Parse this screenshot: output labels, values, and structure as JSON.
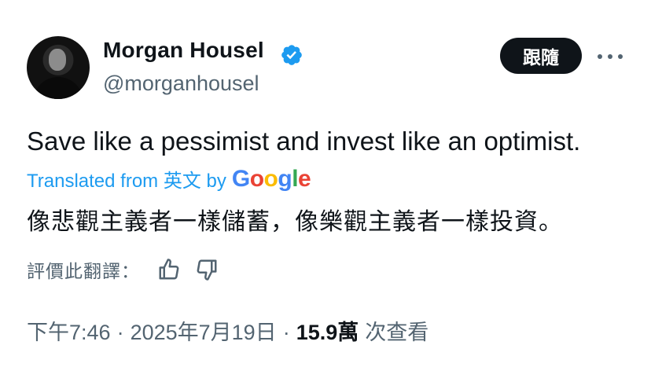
{
  "author": {
    "name": "Morgan Housel",
    "handle": "@morganhousel",
    "verified": true,
    "avatar_icon": "avatar"
  },
  "actions": {
    "follow_label": "跟隨",
    "more_icon": "more-icon"
  },
  "tweet": {
    "text": "Save like a pessimist and invest like an optimist."
  },
  "translation": {
    "label": "Translated from 英文 by",
    "provider": "Google",
    "text": "像悲觀主義者一樣儲蓄，像樂觀主義者一樣投資。"
  },
  "rating": {
    "label": "評價此翻譯：",
    "up_icon": "thumbs-up-icon",
    "down_icon": "thumbs-down-icon"
  },
  "meta": {
    "time": "下午7:46",
    "date": "2025年7月19日",
    "separator": "·",
    "views_count": "15.9萬",
    "views_label": "次查看"
  },
  "colors": {
    "accent": "#1d9bf0",
    "text": "#0f1419",
    "muted": "#536471",
    "button_bg": "#0f1419"
  }
}
